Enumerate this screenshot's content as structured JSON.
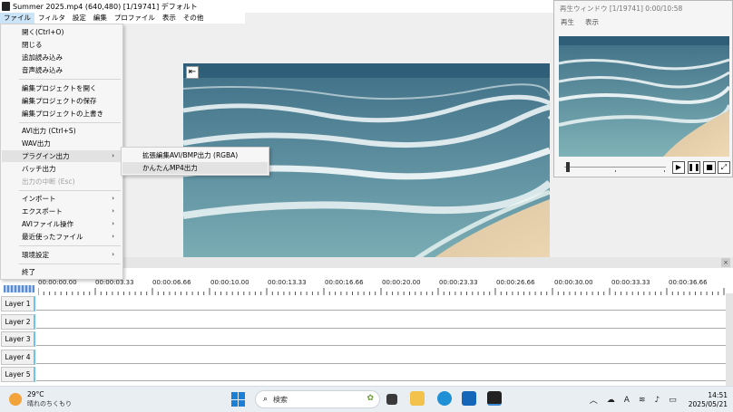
{
  "window": {
    "title": "Summer 2025.mp4 (640,480)  [1/19741]  デフォルト"
  },
  "menubar": [
    "ファイル",
    "フィルタ",
    "設定",
    "編集",
    "プロファイル",
    "表示",
    "その他"
  ],
  "file_menu": {
    "items": [
      {
        "label": "開く(Ctrl+O)"
      },
      {
        "label": "閉じる"
      },
      {
        "label": "追加読み込み"
      },
      {
        "label": "音声読み込み"
      },
      {
        "label": "編集プロジェクトを開く"
      },
      {
        "label": "編集プロジェクトの保存"
      },
      {
        "label": "編集プロジェクトの上書き"
      },
      {
        "label": "AVI出力 (Ctrl+S)"
      },
      {
        "label": "WAV出力"
      },
      {
        "label": "プラグイン出力",
        "arrow": "›"
      },
      {
        "label": "バッチ出力"
      },
      {
        "label": "出力の中断 (Esc)"
      },
      {
        "label": "インポート",
        "arrow": "›"
      },
      {
        "label": "エクスポート",
        "arrow": "›"
      },
      {
        "label": "AVIファイル操作",
        "arrow": "›"
      },
      {
        "label": "最近使ったファイル",
        "arrow": "›"
      },
      {
        "label": "環境設定",
        "arrow": "›"
      },
      {
        "label": "終了"
      }
    ],
    "submenu": [
      "拡張編集AVI/BMP出力 (RGBA)",
      "かんたんMP4出力"
    ]
  },
  "preview": {
    "title": "再生ウィンドウ [1/19741] 0:00/10:58",
    "menu": [
      "再生",
      "表示"
    ]
  },
  "editor": {
    "collapse_icon": "⇤"
  },
  "timeline": {
    "ticks": [
      "00:00:00.00",
      "00:00:03.33",
      "00:00:06.66",
      "00:00:10.00",
      "00:00:13.33",
      "00:00:16.66",
      "00:00:20.00",
      "00:00:23.33",
      "00:00:26.66",
      "00:00:30.00",
      "00:00:33.33",
      "00:00:36.66"
    ],
    "layers": [
      "Layer 1",
      "Layer 2",
      "Layer 3",
      "Layer 4",
      "Layer 5"
    ]
  },
  "taskbar": {
    "weather_temp": "29°C",
    "weather_desc": "晴れのちくもり",
    "search_placeholder": "検索",
    "time": "14:51",
    "date": "2025/05/21"
  },
  "colors": {
    "accent": "#1b7fd6",
    "layer_edge": "#6ec3e9",
    "menu_highlight": "#e2e2e2"
  }
}
